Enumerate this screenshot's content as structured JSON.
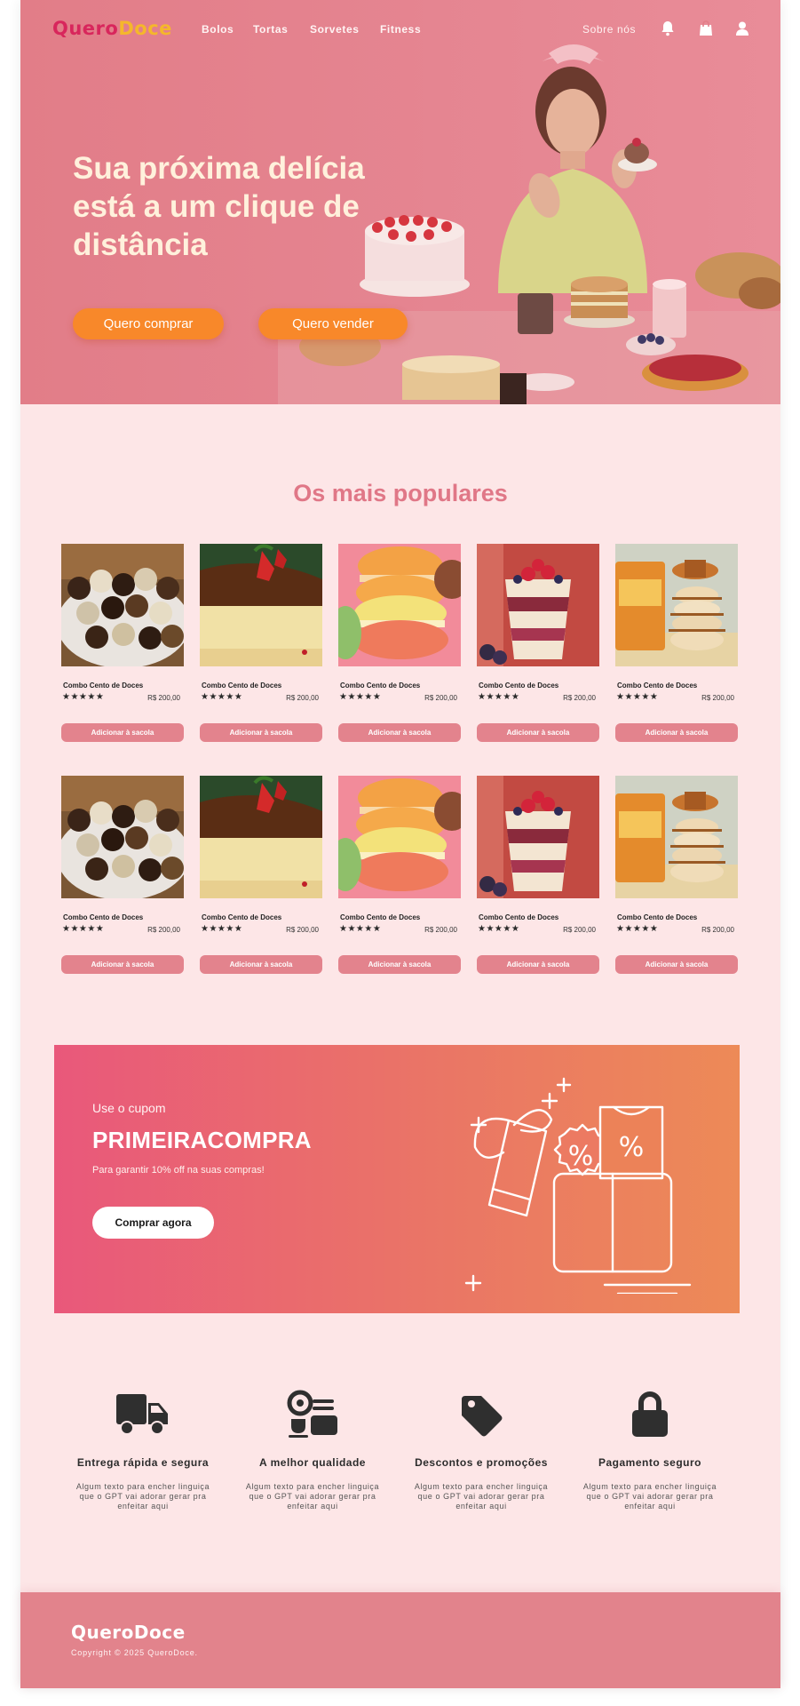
{
  "nav": {
    "logo_part1": "Quero",
    "logo_part2": "Doce",
    "links": [
      "Bolos",
      "Tortas",
      "Sorvetes",
      "Fitness"
    ],
    "about": "Sobre nós",
    "icons": [
      "bell-icon",
      "shopping-bag-icon",
      "user-icon"
    ]
  },
  "hero": {
    "title_lines": [
      "Sua próxima delícia",
      "está a um clique de",
      "distância"
    ],
    "buy_button": "Quero comprar",
    "sell_button": "Quero vender"
  },
  "popular": {
    "title": "Os mais populares",
    "products": [
      {
        "name": "Combo Cento de Doces",
        "stars": "★★★★★",
        "price": "R$ 200,00",
        "button": "Adicionar à sacola",
        "image": "brigadeiros"
      },
      {
        "name": "Combo Cento de Doces",
        "stars": "★★★★★",
        "price": "R$ 200,00",
        "button": "Adicionar à sacola",
        "image": "chocolate-cake"
      },
      {
        "name": "Combo Cento de Doces",
        "stars": "★★★★★",
        "price": "R$ 200,00",
        "button": "Adicionar à sacola",
        "image": "macarons"
      },
      {
        "name": "Combo Cento de Doces",
        "stars": "★★★★★",
        "price": "R$ 200,00",
        "button": "Adicionar à sacola",
        "image": "berry-parfait"
      },
      {
        "name": "Combo Cento de Doces",
        "stars": "★★★★★",
        "price": "R$ 200,00",
        "button": "Adicionar à sacola",
        "image": "alfajores"
      },
      {
        "name": "Combo Cento de Doces",
        "stars": "★★★★★",
        "price": "R$ 200,00",
        "button": "Adicionar à sacola",
        "image": "brigadeiros"
      },
      {
        "name": "Combo Cento de Doces",
        "stars": "★★★★★",
        "price": "R$ 200,00",
        "button": "Adicionar à sacola",
        "image": "chocolate-cake"
      },
      {
        "name": "Combo Cento de Doces",
        "stars": "★★★★★",
        "price": "R$ 200,00",
        "button": "Adicionar à sacola",
        "image": "macarons"
      },
      {
        "name": "Combo Cento de Doces",
        "stars": "★★★★★",
        "price": "R$ 200,00",
        "button": "Adicionar à sacola",
        "image": "berry-parfait"
      },
      {
        "name": "Combo Cento de Doces",
        "stars": "★★★★★",
        "price": "R$ 200,00",
        "button": "Adicionar à sacola",
        "image": "alfajores"
      }
    ]
  },
  "coupon": {
    "pre": "Use o cupom",
    "code": "PRIMEIRACOMPRA",
    "description": "Para garantir 10% off na suas compras!",
    "button": "Comprar agora"
  },
  "features": [
    {
      "icon": "truck-icon",
      "title": "Entrega rápida e segura",
      "description": "Algum texto para encher linguiça que o GPT vai adorar gerar pra enfeitar aqui"
    },
    {
      "icon": "quality-icon",
      "title": "A melhor qualidade",
      "description": "Algum texto para encher linguiça que o GPT vai adorar gerar pra enfeitar aqui"
    },
    {
      "icon": "tag-icon",
      "title": "Descontos e promoções",
      "description": "Algum texto para encher linguiça que o GPT vai adorar gerar pra enfeitar aqui"
    },
    {
      "icon": "lock-icon",
      "title": "Pagamento seguro",
      "description": "Algum texto para encher linguiça que o GPT vai adorar gerar pra enfeitar aqui"
    }
  ],
  "footer": {
    "logo": "QueroDoce",
    "copyright": "Copyright © 2025 QueroDoce."
  },
  "colors": {
    "hero": "#e27d88",
    "accent_orange": "#f8882a",
    "page_bg": "#fde6e7",
    "title_pink": "#e07787",
    "button_pink": "#e3838d",
    "footer": "#e2838c"
  }
}
